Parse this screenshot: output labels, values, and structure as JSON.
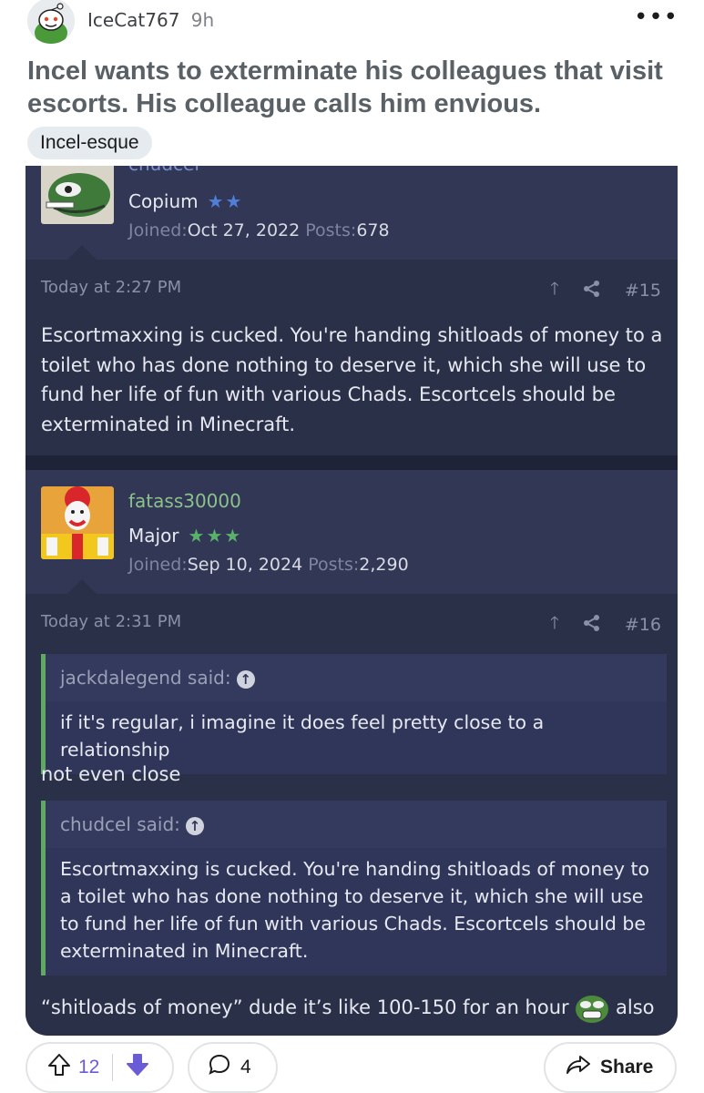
{
  "post": {
    "username": "IceCat767",
    "time_ago": "9h",
    "more_icon": "ellipsis-icon",
    "title": "Incel wants to exterminate his colleagues that visit escorts. His colleague calls him envious.",
    "flair": "Incel-esque"
  },
  "forum": {
    "post1": {
      "username": "chudcel",
      "rank": "Copium",
      "stars": "★★",
      "joined_label": "Joined:",
      "joined": "Oct 27, 2022",
      "posts_label": "Posts:",
      "posts": "678",
      "timestamp": "Today at 2:27 PM",
      "post_number": "#15",
      "body": "Escortmaxxing is cucked. You're handing shitloads of money to a toilet who has done nothing to deserve it, which she will use to fund her life of fun with various Chads. Escortcels should be exterminated in Minecraft."
    },
    "post2": {
      "username": "fatass30000",
      "rank": "Major",
      "stars": "★★★",
      "joined_label": "Joined:",
      "joined": "Sep 10, 2024",
      "posts_label": "Posts:",
      "posts": "2,290",
      "timestamp": "Today at 2:31 PM",
      "post_number": "#16",
      "quote1_author": "jackdalegend said:",
      "quote1_text": "if it's regular, i imagine it does feel pretty close to a relationship",
      "reply1": "not even close",
      "quote2_author": "chudcel said:",
      "quote2_text": "Escortmaxxing is cucked. You're handing shitloads of money to a toilet who has done nothing to deserve it, which she will use to fund her life of fun with various Chads. Escortcels should be exterminated in Minecraft.",
      "reply2": "“shitloads of money” dude it’s like 100-150 for an hour",
      "reply2_tail": "also"
    }
  },
  "actions": {
    "upvotes": "12",
    "comments": "4",
    "share_label": "Share"
  },
  "colors": {
    "forum_bg": "#2b3049",
    "username_green": "#8bc28c",
    "quote_border": "#5fa963",
    "vote_accent": "#6a5cd6"
  }
}
